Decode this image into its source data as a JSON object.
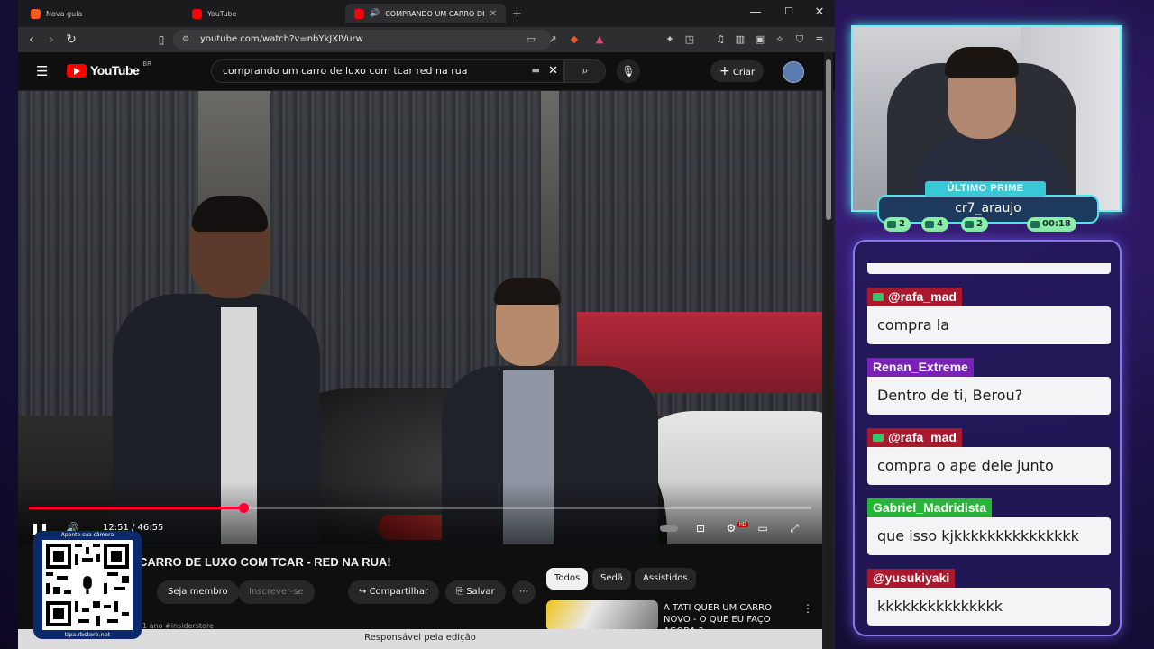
{
  "browser": {
    "tabs": [
      {
        "label": "Nova guia",
        "icon": "brave-icon"
      },
      {
        "label": "YouTube",
        "icon": "youtube-icon"
      },
      {
        "label": "COMPRANDO UM CARRO DE LUXO",
        "icon": "youtube-icon",
        "active": true
      }
    ],
    "window_controls": {
      "minimize": "—",
      "maximize": "☐",
      "close": "✕"
    },
    "url": "youtube.com/watch?v=nbYkJXIVurw",
    "status_text": "Responsável pela edição"
  },
  "youtube": {
    "logo_text": "YouTube",
    "country": "BR",
    "search_value": "comprando um carro de luxo com tcar red na rua",
    "create_label": "Criar",
    "player": {
      "current_time": "12:51",
      "duration": "46:55",
      "time_display": "12:51 / 46:55",
      "progress_fraction": 0.274,
      "hd_badge": "HD"
    },
    "video_title": "COMPRANDO UM CARRO DE LUXO COM TCAR - RED NA RUA!",
    "video_title_visible": "CARRO DE LUXO COM TCAR - RED NA RUA!",
    "buttons": {
      "join": "Seja membro",
      "subscribe": "Inscrever-se",
      "share": "Compartilhar",
      "save": "Salvar",
      "more": "⋯"
    },
    "channel_row": "1 ano   #insiderstore",
    "chips": [
      "Todos",
      "Sedã",
      "Assistidos"
    ],
    "recommendation": {
      "title": "A TATI QUER UM CARRO NOVO - O QUE EU FAÇO AGORA ?"
    }
  },
  "qr_overlay": {
    "top_text": "Aponte sua câmera",
    "bottom_text": "tipa.rbstore.net"
  },
  "stream": {
    "prime_label": "ÚLTIMO PRIME",
    "prime_user": "cr7_araujo",
    "stats": {
      "chat": "2",
      "video": "4",
      "subs": "2",
      "timer": "00:18"
    },
    "chat": [
      {
        "user": "@rafa_mad",
        "text": "compra la",
        "color": "#a8192d",
        "badge": true
      },
      {
        "user": "Renan_Extreme",
        "text": "Dentro de ti, Berou?",
        "color": "#7a22b8",
        "badge": false
      },
      {
        "user": "@rafa_mad",
        "text": "compra o ape dele junto",
        "color": "#a8192d",
        "badge": true
      },
      {
        "user": "Gabriel_Madridista",
        "text": "que isso kjkkkkkkkkkkkkkkk",
        "color": "#27b537",
        "badge": false
      },
      {
        "user": "@yusukiyaki",
        "text": "kkkkkkkkkkkkkkk",
        "color": "#a8192d",
        "badge": false
      }
    ]
  }
}
